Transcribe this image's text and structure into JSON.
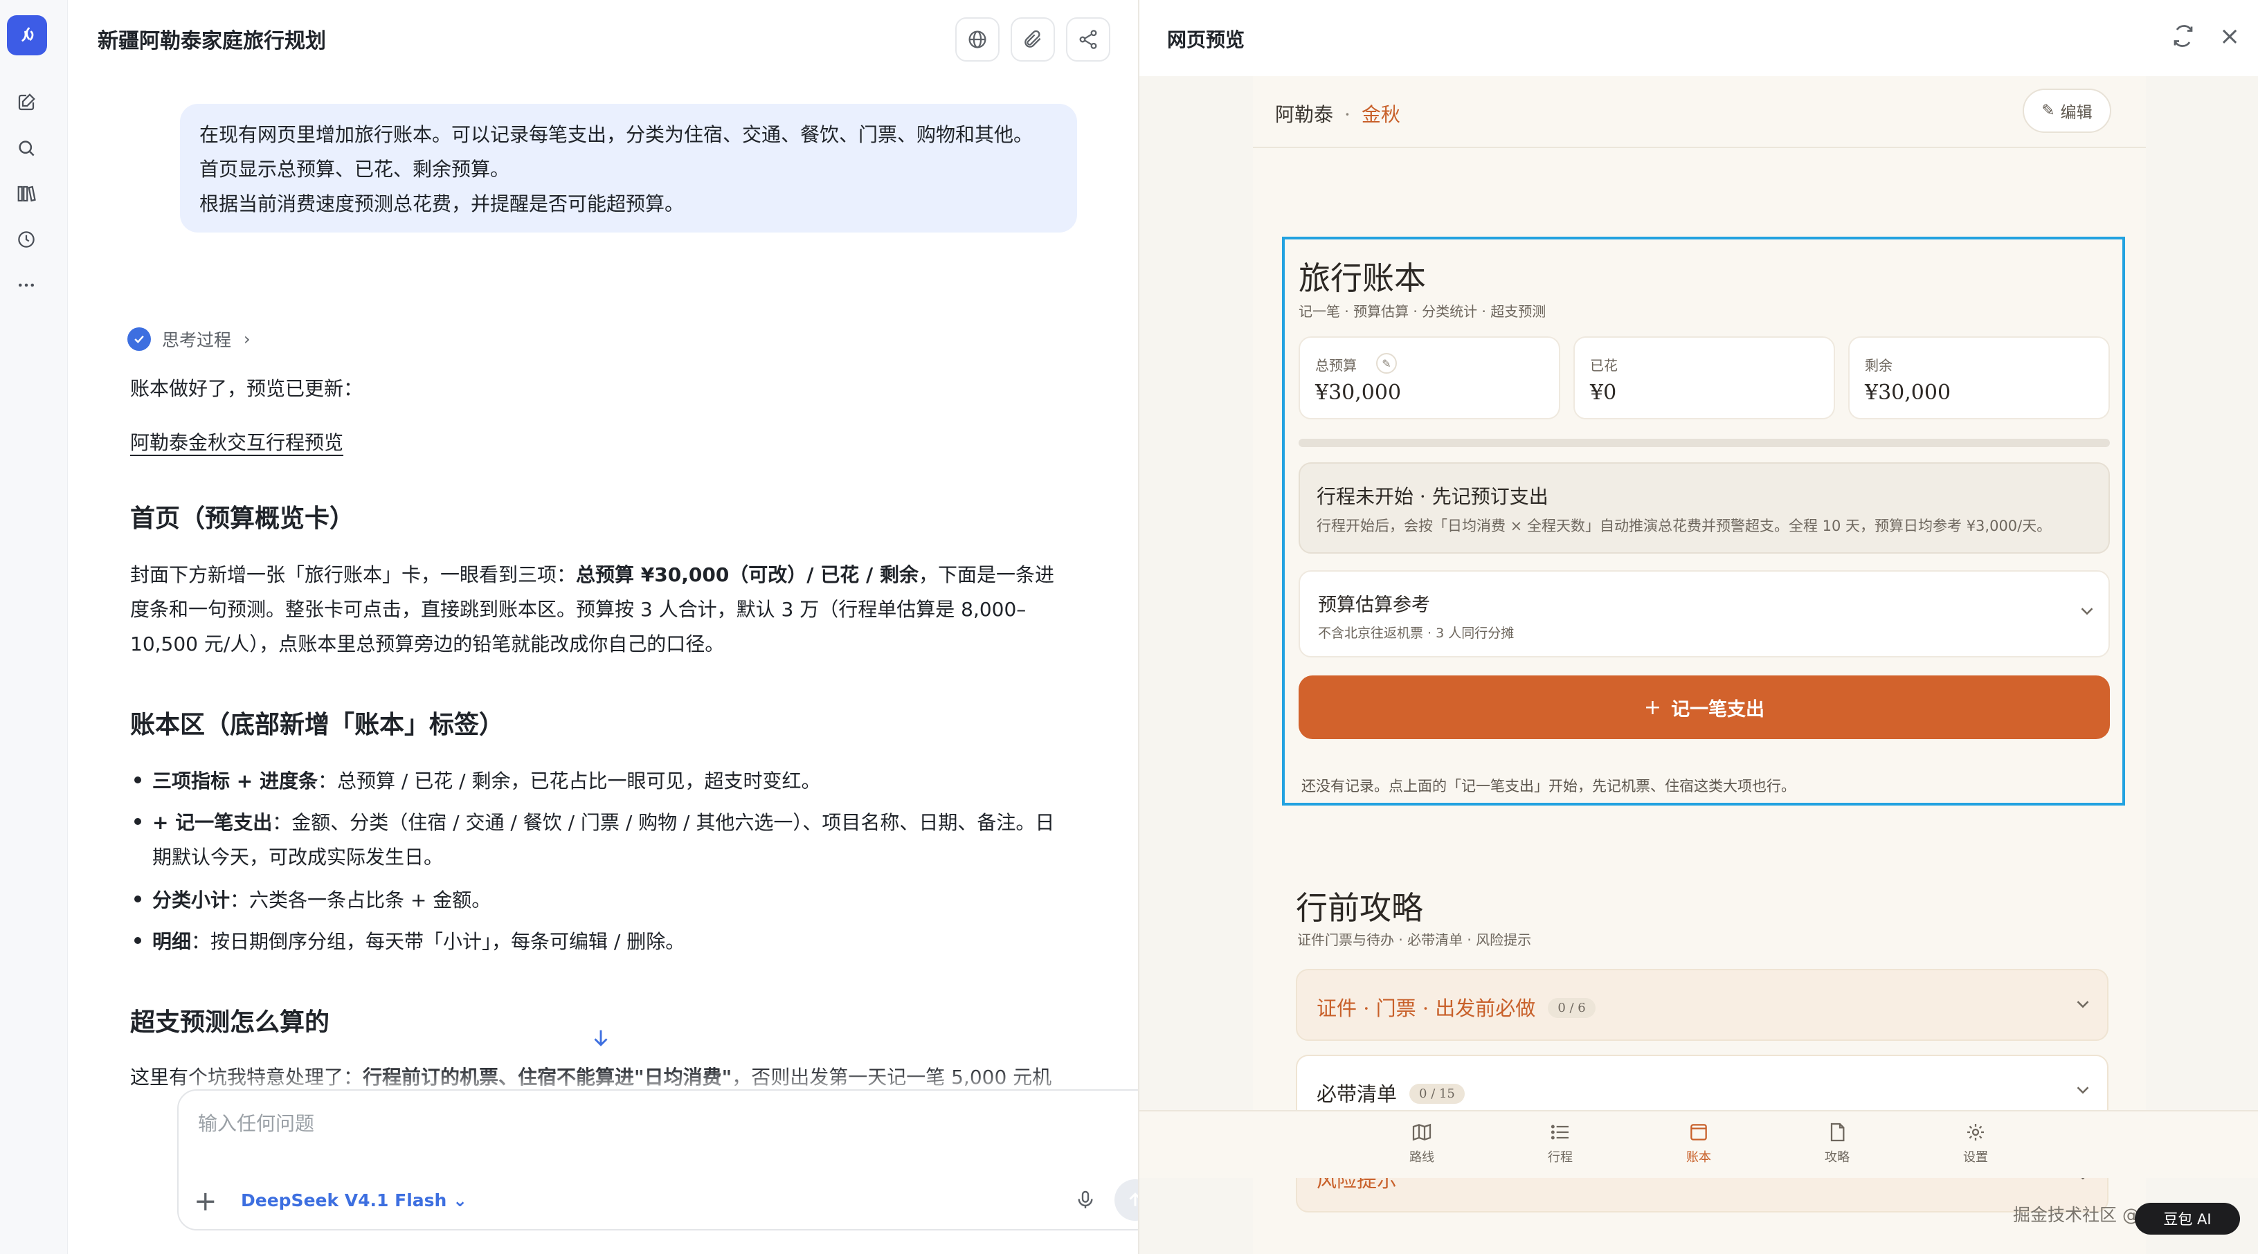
{
  "rail": {
    "icons": [
      "app-logo-icon",
      "new-chat-icon",
      "search-icon",
      "library-icon",
      "history-icon",
      "more-icon"
    ]
  },
  "chat": {
    "title": "新疆阿勒泰家庭旅行规划",
    "user_message": {
      "line1": "在现有网页里增加旅行账本。可以记录每笔支出，分类为住宿、交通、餐饮、门票、购物和其他。",
      "line2": "首页显示总预算、已花、剩余预算。",
      "line3": "根据当前消费速度预测总花费，并提醒是否可能超预算。"
    },
    "thinking_label": "思考过程",
    "reply_intro": "账本做好了，预览已更新：",
    "reply_link": "阿勒泰金秋交互行程预览",
    "section1": {
      "heading": "首页（预算概览卡）",
      "p1_a": "封面下方新增一张「旅行账本」卡，一眼看到三项：",
      "p1_b": "总预算 ¥30,000（可改）/ 已花 / 剩余",
      "p1_c": "，下面是一条进",
      "p2": "度条和一句预测。整张卡可点击，直接跳到账本区。预算按 3 人合计，默认 3 万（行程单估算是 8,000–",
      "p3": "10,500 元/人），点账本里总预算旁边的铅笔就能改成你自己的口径。"
    },
    "section2": {
      "heading": "账本区（底部新增「账本」标签）",
      "b1_bold": "三项指标 + 进度条",
      "b1_text": "：总预算 / 已花 / 剩余，已花占比一眼可见，超支时变红。",
      "b2_bold": "+ 记一笔支出",
      "b2_text": "：金额、分类（住宿 / 交通 / 餐饮 / 门票 / 购物 / 其他六选一）、项目名称、日期、备注。日",
      "b2_cont": "期默认今天，可改成实际发生日。",
      "b3_bold": "分类小计",
      "b3_text": "：六类各一条占比条 + 金额。",
      "b4_bold": "明细",
      "b4_text": "：按日期倒序分组，每天带「小计」，每条可编辑 / 删除。"
    },
    "section3": {
      "heading": "超支预测怎么算的",
      "p1_a": "这里有个坑我特意处理了：",
      "p1_b": "行程前订的机票、住宿不能算进\"日均消费\"",
      "p1_c": "，否则出发第一天记一笔 5,000 元机"
    },
    "input": {
      "placeholder": "输入任何问题",
      "model": "DeepSeek V4.1 Flash"
    }
  },
  "preview": {
    "title": "网页预览",
    "site": {
      "brand": "阿勒泰",
      "brand_sep": "·",
      "brand_accent": "金秋",
      "edit_label": "编辑",
      "ledger": {
        "title": "旅行账本",
        "subtitle": "记一笔 · 预算估算 · 分类统计 · 超支预测",
        "stats": {
          "budget_label": "总预算",
          "budget_value": "¥30,000",
          "spent_label": "已花",
          "spent_value": "¥0",
          "remaining_label": "剩余",
          "remaining_value": "¥30,000"
        },
        "progress_fraction": 0,
        "notice_title": "行程未开始 · 先记预订支出",
        "notice_desc": "行程开始后，会按「日均消费 × 全程天数」自动推演总花费并预警超支。全程 10 天，预算日均参考 ¥3,000/天。",
        "ref_title": "预算估算参考",
        "ref_desc": "不含北京往返机票 · 3 人同行分摊",
        "add_button": "记一笔支出",
        "empty_note": "还没有记录。点上面的「记一笔支出」开始，先记机票、住宿这类大项也行。"
      },
      "guide": {
        "title": "行前攻略",
        "subtitle": "证件门票与待办 · 必带清单 · 风险提示",
        "acc1_title": "证件 · 门票 · 出发前必做",
        "acc1_badge": "0 / 6",
        "acc2_title": "必带清单",
        "acc2_badge": "0 / 15",
        "acc3_title": "风险提示"
      },
      "nav": [
        "路线",
        "行程",
        "账本",
        "攻略",
        "设置"
      ],
      "nav_active": "账本"
    },
    "watermark": "掘金技术社区 @ CodeGenie",
    "watermark_pill": "豆包 AI"
  },
  "colors": {
    "accent": "#c8602a",
    "primary": "#3d6fe0",
    "selection": "#22a2e0"
  }
}
